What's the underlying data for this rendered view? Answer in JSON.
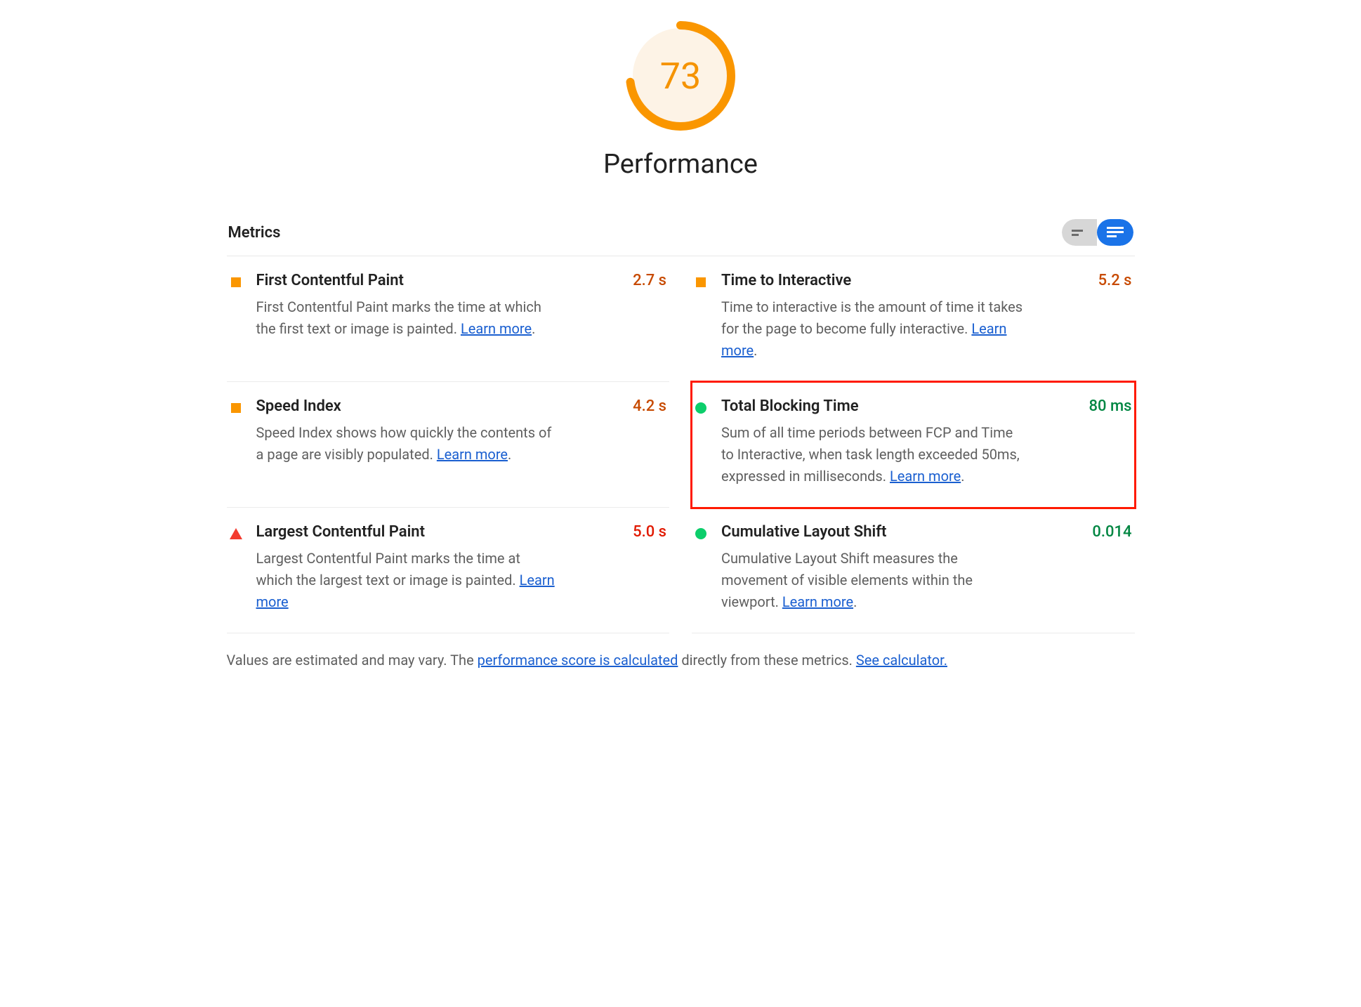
{
  "gauge": {
    "score": "73",
    "title": "Performance",
    "percent": 73
  },
  "section": {
    "title": "Metrics"
  },
  "metrics": [
    {
      "id": "fcp",
      "status": "average",
      "name": "First Contentful Paint",
      "value": "2.7 s",
      "desc_pre": "First Contentful Paint marks the time at which the first text or image is painted. ",
      "learn": "Learn more",
      "desc_post": "."
    },
    {
      "id": "tti",
      "status": "average",
      "name": "Time to Interactive",
      "value": "5.2 s",
      "desc_pre": "Time to interactive is the amount of time it takes for the page to become fully interactive. ",
      "learn": "Learn more",
      "desc_post": "."
    },
    {
      "id": "si",
      "status": "average",
      "name": "Speed Index",
      "value": "4.2 s",
      "desc_pre": "Speed Index shows how quickly the contents of a page are visibly populated. ",
      "learn": "Learn more",
      "desc_post": "."
    },
    {
      "id": "tbt",
      "status": "good",
      "name": "Total Blocking Time",
      "value": "80 ms",
      "highlighted": true,
      "desc_pre": "Sum of all time periods between FCP and Time to Interactive, when task length exceeded 50ms, expressed in milliseconds. ",
      "learn": "Learn more",
      "desc_post": "."
    },
    {
      "id": "lcp",
      "status": "bad",
      "name": "Largest Contentful Paint",
      "value": "5.0 s",
      "desc_pre": "Largest Contentful Paint marks the time at which the largest text or image is painted. ",
      "learn": "Learn more",
      "desc_post": ""
    },
    {
      "id": "cls",
      "status": "good",
      "name": "Cumulative Layout Shift",
      "value": "0.014",
      "desc_pre": "Cumulative Layout Shift measures the movement of visible elements within the viewport. ",
      "learn": "Learn more",
      "desc_post": "."
    }
  ],
  "footnote": {
    "pre": "Values are estimated and may vary. The ",
    "link1": "performance score is calculated",
    "mid": " directly from these metrics. ",
    "link2": "See calculator."
  }
}
